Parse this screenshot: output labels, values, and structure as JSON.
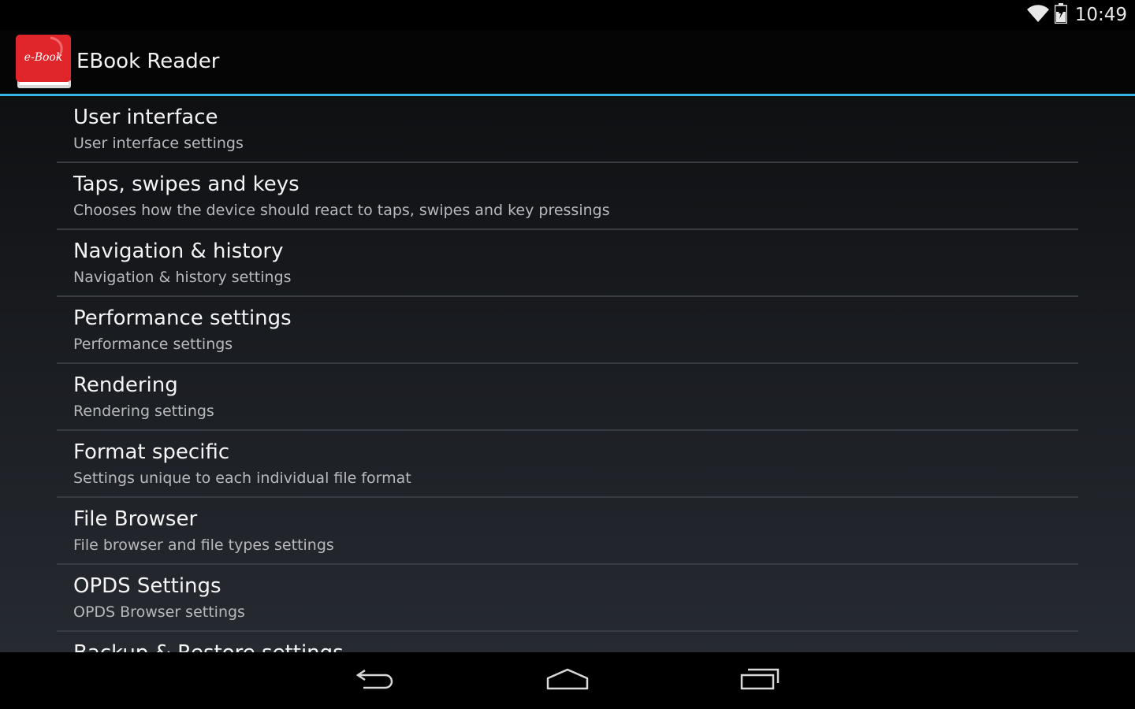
{
  "status_bar": {
    "time": "10:49",
    "icons": [
      "wifi-icon",
      "battery-icon"
    ]
  },
  "action_bar": {
    "app_icon_text": "e-Book",
    "title": "EBook Reader"
  },
  "settings": [
    {
      "title": "User interface",
      "summary": "User interface settings"
    },
    {
      "title": "Taps, swipes and keys",
      "summary": "Chooses how the device should react to taps, swipes and key pressings"
    },
    {
      "title": "Navigation & history",
      "summary": "Navigation & history settings"
    },
    {
      "title": "Performance settings",
      "summary": "Performance settings"
    },
    {
      "title": "Rendering",
      "summary": "Rendering settings"
    },
    {
      "title": "Format specific",
      "summary": "Settings unique to each individual file format"
    },
    {
      "title": "File Browser",
      "summary": "File browser and file types settings"
    },
    {
      "title": "OPDS Settings",
      "summary": "OPDS Browser settings"
    },
    {
      "title": "Backup & Restore settings",
      "summary": ""
    }
  ],
  "nav_bar": {
    "icons": [
      "back-icon",
      "home-icon",
      "recents-icon"
    ]
  },
  "colors": {
    "accent": "#33b5e5",
    "icon_red": "#e0262b",
    "divider": "#383c42"
  }
}
